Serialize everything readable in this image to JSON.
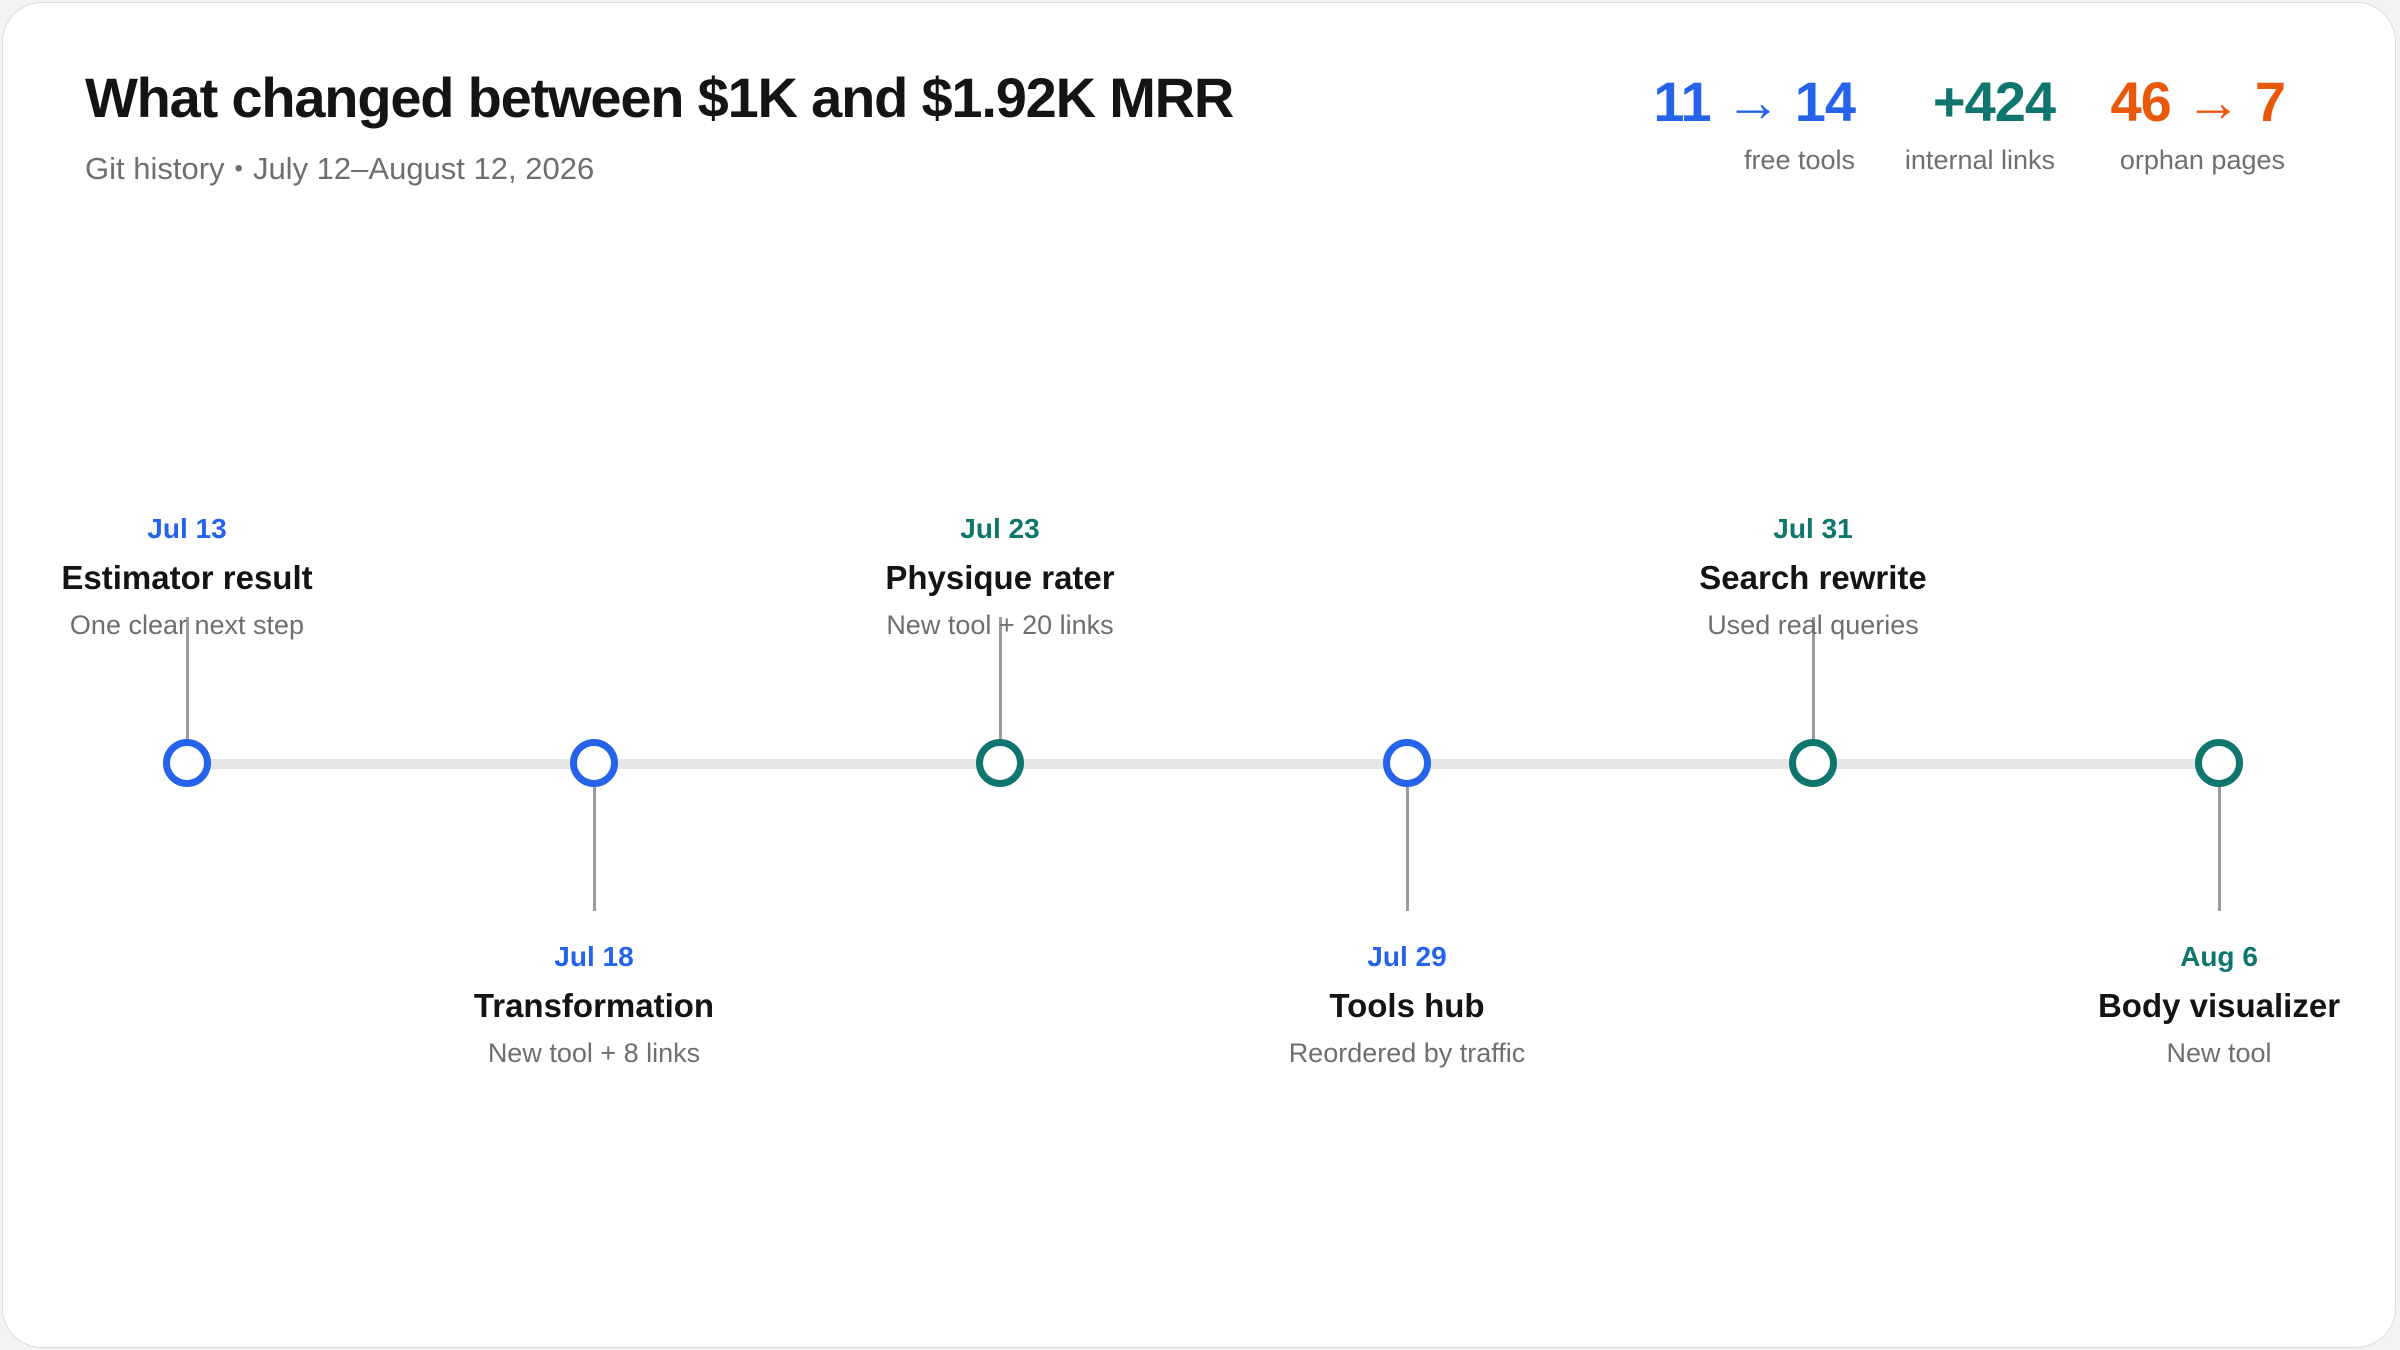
{
  "header": {
    "title": "What changed between $1K and $1.92K MRR",
    "subtitle_source": "Git history",
    "subtitle_dates": "July 12–August 12, 2026"
  },
  "stats": [
    {
      "value": "11 → 14",
      "label": "free tools",
      "color": "#2563eb"
    },
    {
      "value": "+424",
      "label": "internal links",
      "color": "#0f766e"
    },
    {
      "value": "46 → 7",
      "label": "orphan pages",
      "color": "#ea580c"
    }
  ],
  "colors": {
    "blue": "#2563eb",
    "teal": "#0f766e",
    "orange": "#ea580c"
  },
  "timeline": [
    {
      "date": "Jul 13",
      "title": "Estimator result",
      "desc": "One clear next step",
      "color": "blue",
      "side": "above"
    },
    {
      "date": "Jul 18",
      "title": "Transformation",
      "desc": "New tool + 8 links",
      "color": "blue",
      "side": "below"
    },
    {
      "date": "Jul 23",
      "title": "Physique rater",
      "desc": "New tool + 20 links",
      "color": "teal",
      "side": "above"
    },
    {
      "date": "Jul 29",
      "title": "Tools hub",
      "desc": "Reordered by traffic",
      "color": "blue",
      "side": "below"
    },
    {
      "date": "Jul 31",
      "title": "Search rewrite",
      "desc": "Used real queries",
      "color": "teal",
      "side": "above"
    },
    {
      "date": "Aug 6",
      "title": "Body visualizer",
      "desc": "New tool",
      "color": "teal",
      "side": "below"
    }
  ]
}
